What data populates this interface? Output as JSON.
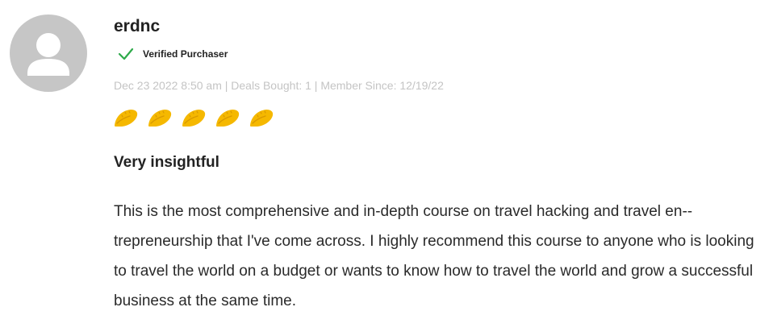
{
  "review": {
    "user": {
      "username": "erdnc",
      "avatar_icon": "user-silhouette-icon",
      "avatar_color": "#c6c6c6"
    },
    "verified": {
      "icon": "checkmark-icon",
      "icon_color": "#2eaa4a",
      "label": "Verified Purchaser"
    },
    "meta": "Dec 23 2022 8:50 am | Deals Bought: 1 | Member Since: 12/19/22",
    "rating": {
      "value": 5,
      "max": 5,
      "icon": "taco-icon",
      "color": "#f5b800"
    },
    "title": "Very insightful",
    "body": "This is the most comprehensive and in-depth course on travel hacking and travel en-­trepreneurship that I've come across. I highly recommend this course to anyone who is looking to travel the world on a budget or wants to know how to travel the world and grow a successful business at the same time."
  }
}
